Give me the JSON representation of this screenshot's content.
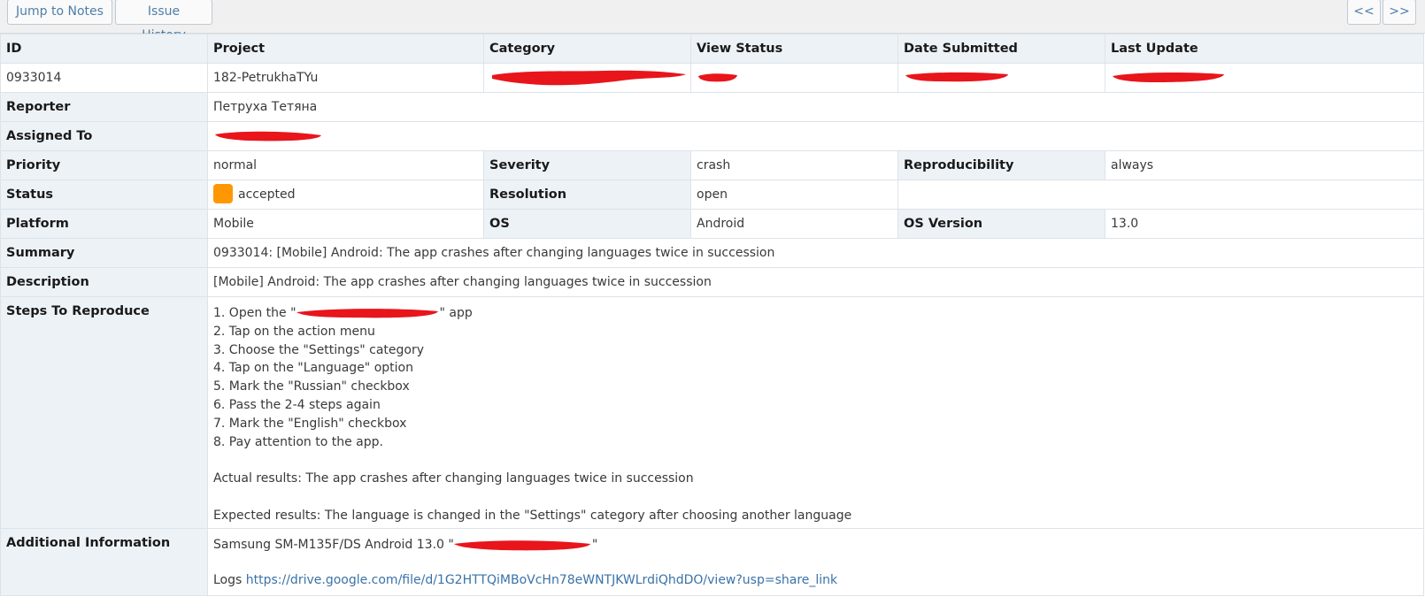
{
  "toolbar": {
    "jump_to_notes": "Jump to Notes",
    "issue_history": "Issue History",
    "prev": "<<",
    "next": ">>"
  },
  "columns": [
    "ID",
    "Project",
    "Category",
    "View Status",
    "Date Submitted",
    "Last Update"
  ],
  "issue": {
    "id": "0933014",
    "project": "182-PetrukhaTYu",
    "reporter_label": "Reporter",
    "reporter": "Петруха Тетяна",
    "assigned_label": "Assigned To",
    "priority_label": "Priority",
    "priority": "normal",
    "severity_label": "Severity",
    "severity": "crash",
    "reproducibility_label": "Reproducibility",
    "reproducibility": "always",
    "status_label": "Status",
    "status": "accepted",
    "status_color": "#ff9800",
    "resolution_label": "Resolution",
    "resolution": "open",
    "platform_label": "Platform",
    "platform": "Mobile",
    "os_label": "OS",
    "os": "Android",
    "os_version_label": "OS Version",
    "os_version": "13.0",
    "summary_label": "Summary",
    "summary": "0933014: [Mobile] Android: The app crashes after changing languages twice in succession",
    "description_label": "Description",
    "description": "[Mobile] Android: The app crashes after changing languages twice in succession",
    "steps_label": "Steps To Reproduce",
    "steps_first_prefix": "1. Open the \"",
    "steps_first_suffix": "\" app",
    "steps_rest": "2. Tap on the action menu\n3. Choose the \"Settings\" category\n4. Tap on the \"Language\" option\n5. Mark the \"Russian\" checkbox\n6. Pass the 2-4 steps again\n7. Mark the \"English\" checkbox\n8. Pay attention to the app.\n\nActual results: The app crashes after changing languages twice in succession\n\nExpected results: The language is changed in the \"Settings\" category after choosing another language",
    "additional_label": "Additional Information",
    "additional_prefix": "Samsung SM-M135F/DS Android 13.0 \"",
    "additional_suffix": "\"",
    "logs_label": "Logs ",
    "logs_url": "https://drive.google.com/file/d/1G2HTTQiMBoVcHn78eWNTJKWLrdiQhdDO/view?usp=share_link"
  },
  "redaction_color": "#e8151b"
}
